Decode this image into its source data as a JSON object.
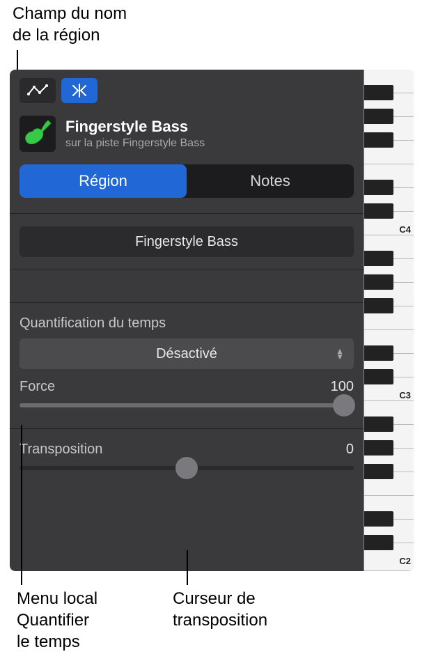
{
  "callouts": {
    "region_name_field": "Champ du nom\nde la région",
    "quantize_menu": "Menu local\nQuantifier\nle temps",
    "transpose_slider": "Curseur de\ntransposition"
  },
  "region": {
    "title": "Fingerstyle Bass",
    "subtitle": "sur la piste Fingerstyle Bass",
    "name_field_value": "Fingerstyle Bass"
  },
  "tabs": {
    "region": "Région",
    "notes": "Notes"
  },
  "quantize": {
    "label": "Quantification du temps",
    "value": "Désactivé"
  },
  "strength": {
    "label": "Force",
    "value": "100",
    "percent": 100
  },
  "transpose": {
    "label": "Transposition",
    "value": "0",
    "percent": 50
  },
  "piano": {
    "labels": [
      "C4",
      "C3",
      "C2"
    ]
  }
}
